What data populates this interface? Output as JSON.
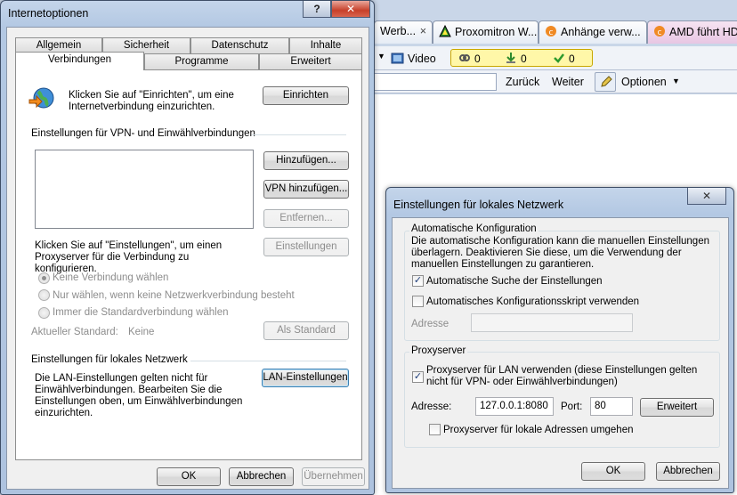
{
  "browser": {
    "tabs": [
      {
        "label": "Werb...",
        "close": "×"
      },
      {
        "label": "Proxomitron W..."
      },
      {
        "label": "Anhänge verw..."
      },
      {
        "label": "AMD führt HD"
      }
    ],
    "video_label": "Video",
    "counters": [
      "0",
      "0",
      "0"
    ],
    "back_label": "Zurück",
    "forward_label": "Weiter",
    "options_label": "Optionen",
    "options_arrow": "▼"
  },
  "internet_options": {
    "title": "Internetoptionen",
    "help_glyph": "?",
    "close_glyph": "✕",
    "tabs_row1": [
      "Allgemein",
      "Sicherheit",
      "Datenschutz",
      "Inhalte"
    ],
    "tabs_row2": [
      "Verbindungen",
      "Programme",
      "Erweitert"
    ],
    "setup_text": "Klicken Sie auf \"Einrichten\", um eine Internetverbindung einzurichten.",
    "setup_button": "Einrichten",
    "vpn_section": "Einstellungen für VPN- und Einwählverbindungen",
    "add_button": "Hinzufügen...",
    "add_vpn_button": "VPN hinzufügen...",
    "remove_button": "Entfernen...",
    "proxy_text": "Klicken Sie auf \"Einstellungen\", um einen Proxyserver für die Verbindung zu konfigurieren.",
    "settings_button": "Einstellungen",
    "radio_options": [
      {
        "label": "Keine Verbindung wählen",
        "checked": true
      },
      {
        "label": "Nur wählen, wenn keine Netzwerkverbindung besteht",
        "checked": false
      },
      {
        "label": "Immer die Standardverbindung wählen",
        "checked": false
      }
    ],
    "current_default_label": "Aktueller Standard:",
    "current_default_value": "Keine",
    "set_default_button": "Als Standard",
    "lan_section": "Einstellungen für lokales Netzwerk",
    "lan_text": "Die LAN-Einstellungen gelten nicht für Einwählverbindungen. Bearbeiten Sie die Einstellungen oben, um Einwählverbindungen einzurichten.",
    "lan_button": "LAN-Einstellungen",
    "ok_button": "OK",
    "cancel_button": "Abbrechen",
    "apply_button": "Übernehmen"
  },
  "lan_settings": {
    "title": "Einstellungen für lokales Netzwerk",
    "close_glyph": "✕",
    "auto_group": "Automatische Konfiguration",
    "auto_desc": "Die automatische Konfiguration kann die manuellen Einstellungen überlagern. Deaktivieren Sie diese, um die Verwendung der manuellen Einstellungen zu garantieren.",
    "auto_detect_label": "Automatische Suche der Einstellungen",
    "auto_detect_checked": true,
    "auto_script_label": "Automatisches Konfigurationsskript verwenden",
    "auto_script_checked": false,
    "address_label": "Adresse",
    "address_value": "",
    "proxy_group": "Proxyserver",
    "proxy_use_label": "Proxyserver für LAN verwenden (diese Einstellungen gelten nicht für VPN- oder Einwählverbindungen)",
    "proxy_use_checked": true,
    "proxy_address_label": "Adresse:",
    "proxy_address_value": "127.0.0.1:8080",
    "port_label": "Port:",
    "port_value": "80",
    "advanced_button": "Erweitert",
    "bypass_label": "Proxyserver für lokale Adressen umgehen",
    "bypass_checked": false,
    "ok_button": "OK",
    "cancel_button": "Abbrechen"
  },
  "colors": {
    "dialog_frame": "#b3c8e3",
    "client": "#f0f0f0",
    "amd_tab": "#e8c6e3",
    "counter_bg": "#fff7a8"
  }
}
